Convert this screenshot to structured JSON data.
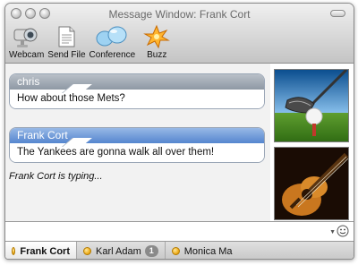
{
  "window": {
    "title": "Message Window: Frank Cort"
  },
  "toolbar": {
    "items": [
      {
        "label": "Webcam",
        "icon": "webcam-icon"
      },
      {
        "label": "Send File",
        "icon": "send-file-icon"
      },
      {
        "label": "Conference",
        "icon": "conference-icon"
      },
      {
        "label": "Buzz",
        "icon": "buzz-icon"
      }
    ]
  },
  "messages": [
    {
      "sender": "chris",
      "text": "How about those Mets?",
      "style": "grey"
    },
    {
      "sender": "Frank Cort",
      "text": "The Yankees are gonna walk all over them!",
      "style": "blue"
    }
  ],
  "status": {
    "typing": "Frank Cort is typing..."
  },
  "input": {
    "value": "",
    "placeholder": ""
  },
  "tabs": [
    {
      "label": "Frank Cort",
      "active": true
    },
    {
      "label": "Karl Adam",
      "badge": "1"
    },
    {
      "label": "Monica Ma"
    }
  ],
  "colors": {
    "bubble_blue": "#5586cf",
    "bubble_grey": "#8e98a4",
    "status_dot": "#f0b020"
  }
}
